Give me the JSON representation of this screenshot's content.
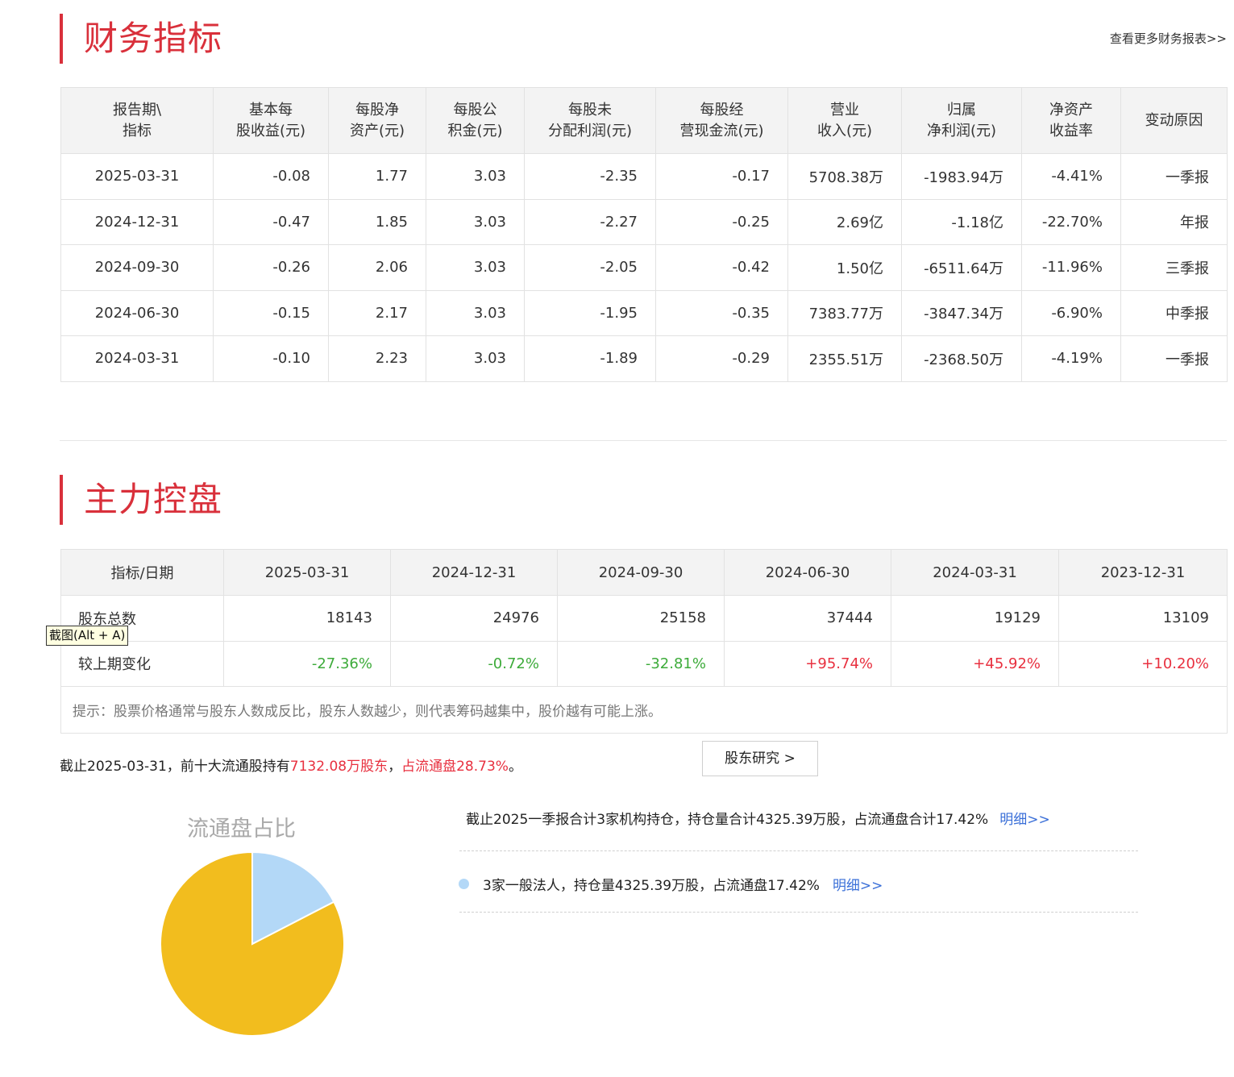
{
  "finance": {
    "title": "财务指标",
    "more_link": "查看更多财务报表>>",
    "headers": [
      [
        "报告期\\",
        "指标"
      ],
      [
        "基本每",
        "股收益(元)"
      ],
      [
        "每股净",
        "资产(元)"
      ],
      [
        "每股公",
        "积金(元)"
      ],
      [
        "每股未",
        "分配利润(元)"
      ],
      [
        "每股经",
        "营现金流(元)"
      ],
      [
        "营业",
        "收入(元)"
      ],
      [
        "归属",
        "净利润(元)"
      ],
      [
        "净资产",
        "收益率"
      ],
      [
        "变动原因"
      ]
    ],
    "rows": [
      [
        "2025-03-31",
        "-0.08",
        "1.77",
        "3.03",
        "-2.35",
        "-0.17",
        "5708.38万",
        "-1983.94万",
        "-4.41%",
        "一季报"
      ],
      [
        "2024-12-31",
        "-0.47",
        "1.85",
        "3.03",
        "-2.27",
        "-0.25",
        "2.69亿",
        "-1.18亿",
        "-22.70%",
        "年报"
      ],
      [
        "2024-09-30",
        "-0.26",
        "2.06",
        "3.03",
        "-2.05",
        "-0.42",
        "1.50亿",
        "-6511.64万",
        "-11.96%",
        "三季报"
      ],
      [
        "2024-06-30",
        "-0.15",
        "2.17",
        "3.03",
        "-1.95",
        "-0.35",
        "7383.77万",
        "-3847.34万",
        "-6.90%",
        "中季报"
      ],
      [
        "2024-03-31",
        "-0.10",
        "2.23",
        "3.03",
        "-1.89",
        "-0.29",
        "2355.51万",
        "-2368.50万",
        "-4.19%",
        "一季报"
      ]
    ]
  },
  "control": {
    "title": "主力控盘",
    "header_label": "指标/日期",
    "dates": [
      "2025-03-31",
      "2024-12-31",
      "2024-09-30",
      "2024-06-30",
      "2024-03-31",
      "2023-12-31"
    ],
    "holders_label": "股东总数",
    "holders": [
      "18143",
      "24976",
      "25158",
      "37444",
      "19129",
      "13109"
    ],
    "change_label": "较上期变化",
    "changes": [
      "-27.36%",
      "-0.72%",
      "-32.81%",
      "+95.74%",
      "+45.92%",
      "+10.20%"
    ],
    "tip": "提示：股票价格通常与股东人数成反比，股东人数越少，则代表筹码越集中，股价越有可能上涨。"
  },
  "tooltip": "截图(Alt + A)",
  "summary": {
    "prefix": "截止2025-03-31，前十大流通股持有",
    "holding": "7132.08万股东",
    "comma": "，",
    "ratio": "占流通盘28.73%",
    "suffix": "。"
  },
  "research_button": "股东研究 >",
  "pie": {
    "title": "流通盘占比",
    "slices": [
      {
        "value": 17.42,
        "color": "#b3d8f7"
      },
      {
        "value": 82.58,
        "color": "#f2bd1e"
      }
    ]
  },
  "institutions": {
    "line": "截止2025一季报合计3家机构持仓，持仓量合计4325.39万股，占流通盘合计17.42%",
    "link": "明细>>",
    "item": "3家一般法人，持仓量4325.39万股，占流通盘17.42%",
    "item_link": "明细>>"
  },
  "colors": {
    "accent": "#d9303b",
    "up": "#e8303f",
    "down": "#3dab3a",
    "link": "#3a6fd8"
  }
}
